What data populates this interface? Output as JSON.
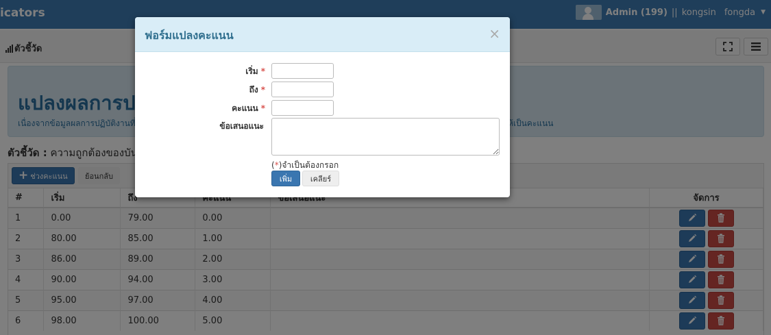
{
  "navbar": {
    "brand": "icators",
    "user": "Admin (199)",
    "separator": "||",
    "account": "kongsin",
    "org": "fongda"
  },
  "subheader": {
    "breadcrumb": "ตัวชี้วัด"
  },
  "jumbotron": {
    "title": "แปลงผลการปฏิบัติงานเป็นคะแนน",
    "description": "เนื่องจากข้อมูลผลการปฏิบัติงานที่ได้จากการเก็บรวบรวมข้อมูลมีหลายรูปแบบ จึงต้องมีการแปลงข้อมูลเพื่อให้ข้อมูลอยู่ในรูปแบบเดียวกันโดยให้เป็นคะแนน"
  },
  "indicator": {
    "label": "ตัวชี้วัด :",
    "value": "ความถูกต้องของบันทึกข้อมูล"
  },
  "panel": {
    "add_label": "ช่วงคะแนน",
    "back_label": "ย้อนกลับ"
  },
  "table": {
    "headers": [
      "#",
      "เริ่ม",
      "ถึง",
      "คะแนน",
      "ข้อเสนอแนะ",
      "จัดการ"
    ],
    "rows": [
      {
        "no": "1",
        "start": "0.00",
        "end": "79.00",
        "score": "0.00",
        "note": ""
      },
      {
        "no": "2",
        "start": "80.00",
        "end": "85.00",
        "score": "1.00",
        "note": ""
      },
      {
        "no": "3",
        "start": "86.00",
        "end": "89.00",
        "score": "2.00",
        "note": ""
      },
      {
        "no": "4",
        "start": "90.00",
        "end": "94.00",
        "score": "3.00",
        "note": ""
      },
      {
        "no": "5",
        "start": "95.00",
        "end": "97.00",
        "score": "4.00",
        "note": ""
      },
      {
        "no": "6",
        "start": "98.00",
        "end": "100.00",
        "score": "5.00",
        "note": ""
      }
    ]
  },
  "modal": {
    "title": "ฟอร์มแปลงคะแนน",
    "close": "×",
    "start_label": "เริ่ม",
    "end_label": "ถึง",
    "score_label": "คะแนน",
    "suggest_label": "ข้อเสนอแนะ",
    "required_mark": "*",
    "start_value": "",
    "end_value": "",
    "score_value": "",
    "suggest_value": "",
    "required_note": "จำเป็นต้องกรอก",
    "add_button": "เพิ่ม",
    "clear_button": "เคลียร์"
  },
  "colors": {
    "navbar": "#3f7cb4",
    "primary": "#3a76b0",
    "danger": "#cb4a44",
    "jumbotron": "#d6e7f0",
    "modal_header": "#d9edf7"
  }
}
